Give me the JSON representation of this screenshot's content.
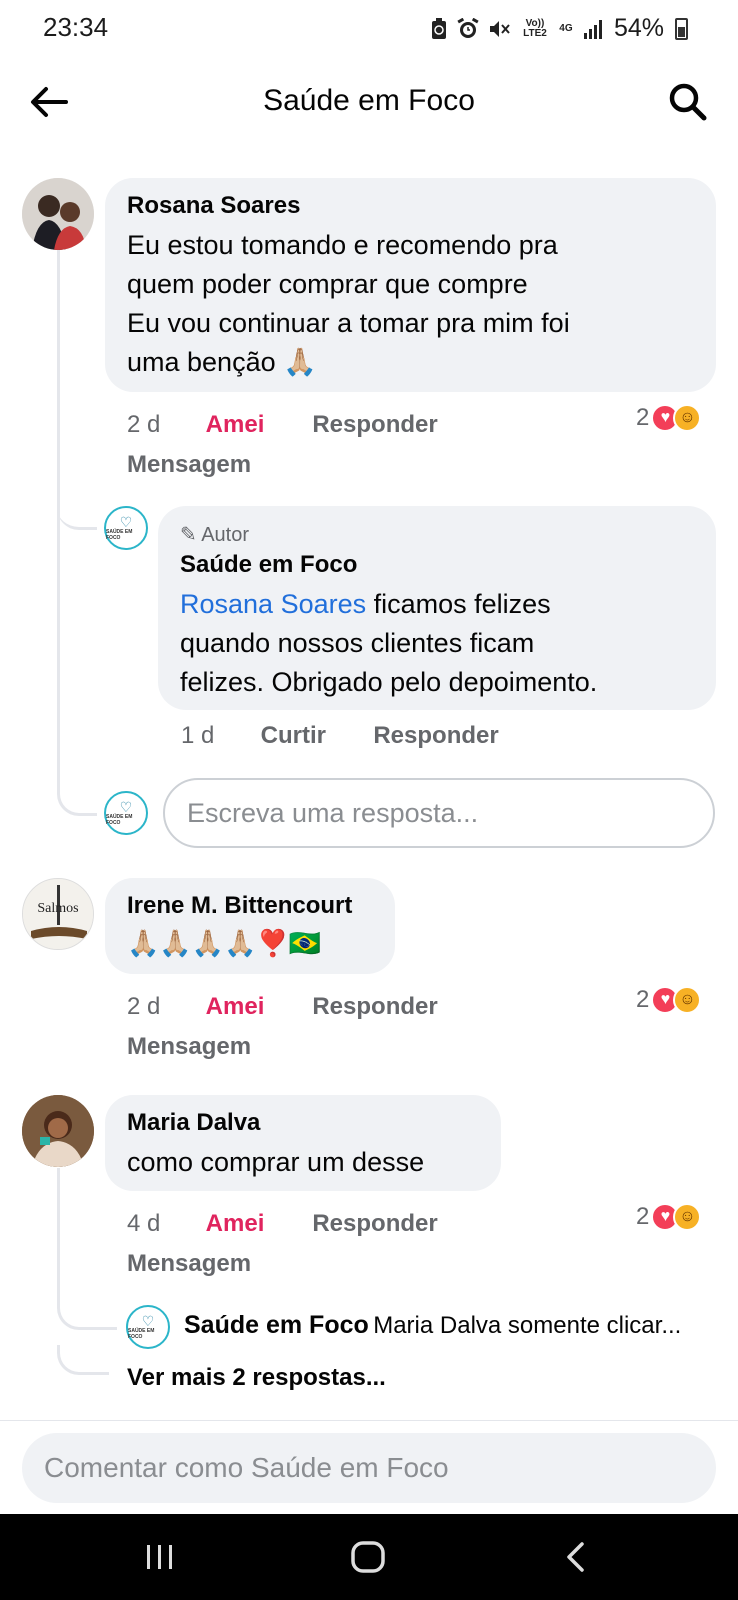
{
  "status_bar": {
    "time": "23:34",
    "battery": "54%",
    "volte_label": "Vo)) LTE2",
    "net_label": "4G",
    "icons": [
      "battery-saver-icon",
      "alarm-icon",
      "mute-icon",
      "volte-icon",
      "network-4g-icon",
      "signal-icon",
      "battery-icon"
    ]
  },
  "header": {
    "title": "Saúde em Foco",
    "back_icon": "arrow-left-icon",
    "search_icon": "search-icon"
  },
  "comments": [
    {
      "author": "Rosana Soares",
      "lines": [
        "Eu estou tomando e recomendo pra",
        "quem poder comprar que compre",
        "Eu vou continuar a tomar pra mim foi",
        "uma benção 🙏🏼"
      ],
      "time": "2 d",
      "reaction_label": "Amei",
      "reply_label": "Responder",
      "message_label": "Mensagem",
      "reaction_count": "2",
      "reply": {
        "badge": "Autor",
        "author": "Saúde em Foco",
        "mention": "Rosana Soares",
        "lines": [
          " ficamos felizes",
          "quando nossos clientes ficam",
          "felizes. Obrigado pelo depoimento."
        ],
        "time": "1 d",
        "like_label": "Curtir",
        "reply_label": "Responder"
      },
      "reply_placeholder": "Escreva uma resposta..."
    },
    {
      "author": "Irene M. Bittencourt",
      "avatar_text": "Salmos",
      "text": "🙏🏼🙏🏼🙏🏼🙏🏼❣️🇧🇷",
      "time": "2 d",
      "reaction_label": "Amei",
      "reply_label": "Responder",
      "message_label": "Mensagem",
      "reaction_count": "2"
    },
    {
      "author": "Maria Dalva",
      "text": "como comprar um desse",
      "time": "4 d",
      "reaction_label": "Amei",
      "reply_label": "Responder",
      "message_label": "Mensagem",
      "reaction_count": "2",
      "reply_preview_author": "Saúde em Foco",
      "reply_preview_text": "Maria Dalva somente clicar...",
      "more_replies": "Ver mais 2 respostas..."
    }
  ],
  "page_avatar_text": "SAÚDE EM FOCO",
  "comment_placeholder": "Comentar como Saúde em Foco",
  "nav": {
    "icons": [
      "recent-apps-icon",
      "home-icon",
      "back-nav-icon"
    ]
  },
  "colors": {
    "bubble": "#f0f2f5",
    "amei": "#e0245e",
    "link": "#216fdb",
    "meta": "#65676b"
  }
}
